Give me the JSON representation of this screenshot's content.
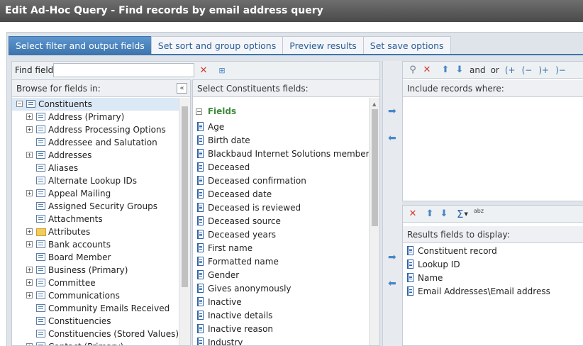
{
  "window": {
    "title": "Edit Ad-Hoc Query - Find records by email address query"
  },
  "tabs": [
    {
      "label": "Select filter and output fields",
      "active": true
    },
    {
      "label": "Set sort and group options",
      "active": false
    },
    {
      "label": "Preview results",
      "active": false
    },
    {
      "label": "Set save options",
      "active": false
    }
  ],
  "find": {
    "label": "Find field:",
    "value": ""
  },
  "browse": {
    "header": "Browse for fields in:"
  },
  "tree": [
    {
      "label": "Constituents",
      "level": 0,
      "expander": "−",
      "icon": "table-icon",
      "selected": true
    },
    {
      "label": "Address (Primary)",
      "level": 1,
      "expander": "+",
      "icon": "table-icon"
    },
    {
      "label": "Address Processing Options",
      "level": 1,
      "expander": "+",
      "icon": "table-icon"
    },
    {
      "label": "Addressee and Salutation",
      "level": 1,
      "expander": "",
      "icon": "table-icon"
    },
    {
      "label": "Addresses",
      "level": 1,
      "expander": "+",
      "icon": "table-icon"
    },
    {
      "label": "Aliases",
      "level": 1,
      "expander": "",
      "icon": "table-icon"
    },
    {
      "label": "Alternate Lookup IDs",
      "level": 1,
      "expander": "",
      "icon": "table-icon"
    },
    {
      "label": "Appeal Mailing",
      "level": 1,
      "expander": "+",
      "icon": "table-icon"
    },
    {
      "label": "Assigned Security Groups",
      "level": 1,
      "expander": "",
      "icon": "table-icon"
    },
    {
      "label": "Attachments",
      "level": 1,
      "expander": "",
      "icon": "table-icon"
    },
    {
      "label": "Attributes",
      "level": 1,
      "expander": "+",
      "icon": "folder-icon"
    },
    {
      "label": "Bank accounts",
      "level": 1,
      "expander": "+",
      "icon": "table-icon"
    },
    {
      "label": "Board Member",
      "level": 1,
      "expander": "",
      "icon": "table-icon"
    },
    {
      "label": "Business (Primary)",
      "level": 1,
      "expander": "+",
      "icon": "table-icon"
    },
    {
      "label": "Committee",
      "level": 1,
      "expander": "+",
      "icon": "table-icon"
    },
    {
      "label": "Communications",
      "level": 1,
      "expander": "+",
      "icon": "table-icon"
    },
    {
      "label": "Community Emails Received",
      "level": 1,
      "expander": "",
      "icon": "table-icon"
    },
    {
      "label": "Constituencies",
      "level": 1,
      "expander": "",
      "icon": "table-icon"
    },
    {
      "label": "Constituencies (Stored Values)",
      "level": 1,
      "expander": "",
      "icon": "table-icon"
    },
    {
      "label": "Contact (Primary)",
      "level": 1,
      "expander": "+",
      "icon": "table-icon"
    }
  ],
  "select_fields": {
    "header": "Select Constituents fields:",
    "group_label": "Fields",
    "items": [
      "Age",
      "Birth date",
      "Blackbaud Internet Solutions member",
      "Deceased",
      "Deceased confirmation",
      "Deceased date",
      "Deceased is reviewed",
      "Deceased source",
      "Deceased years",
      "First name",
      "Formatted name",
      "Gender",
      "Gives anonymously",
      "Inactive",
      "Inactive details",
      "Inactive reason",
      "Industry"
    ]
  },
  "filter": {
    "header": "Include records where:",
    "toolbar": {
      "and": "and",
      "or": "or",
      "open_plus": "(+",
      "open_minus": "(−",
      "close_plus": ")+",
      "close_minus": ")−"
    }
  },
  "results": {
    "header": "Results fields to display:",
    "items": [
      "Constituent record",
      "Lookup ID",
      "Name",
      "Email Addresses\\Email address"
    ],
    "sigma": "Σ",
    "abz": "abz"
  }
}
